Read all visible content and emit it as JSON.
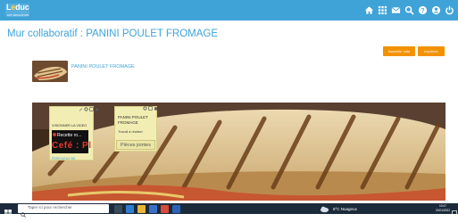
{
  "header": {
    "logo_text": "L",
    "logo_e": "e",
    "logo_rest": "duc",
    "logo_sub": "ENT ÉDUCATION",
    "icons": [
      "home-icon",
      "apps-grid-icon",
      "mail-icon",
      "search-icon",
      "help-icon",
      "user-icon",
      "power-icon"
    ]
  },
  "page": {
    "title": "Mur collaboratif : PANINI POULET FROMAGE",
    "new_note_label": "Nouvelle note",
    "print_label": "Imprimer"
  },
  "wall_item": {
    "title": "PANINI POULET FROMAGE"
  },
  "note_video": {
    "label": "VISIONNER LA VIDEO",
    "video_title": "Recette ro...",
    "video_brand": "Cefé : Pl",
    "link": "PERIGUEUX BS"
  },
  "note_info": {
    "text": "PANINI POULET FROMAGE",
    "subtext": "Travail à réaliser",
    "attachments_label": "Pièces jointes"
  },
  "taskbar": {
    "search_placeholder": "Taper ici pour rechercher",
    "weather": "8°C Nuageux",
    "time": "10:47",
    "date": "20/01/2022"
  },
  "colors": {
    "brand_blue": "#3fa3d8",
    "orange": "#f39200",
    "note_yellow": "#f2eeb3",
    "taskbar": "#1c2b3b"
  }
}
